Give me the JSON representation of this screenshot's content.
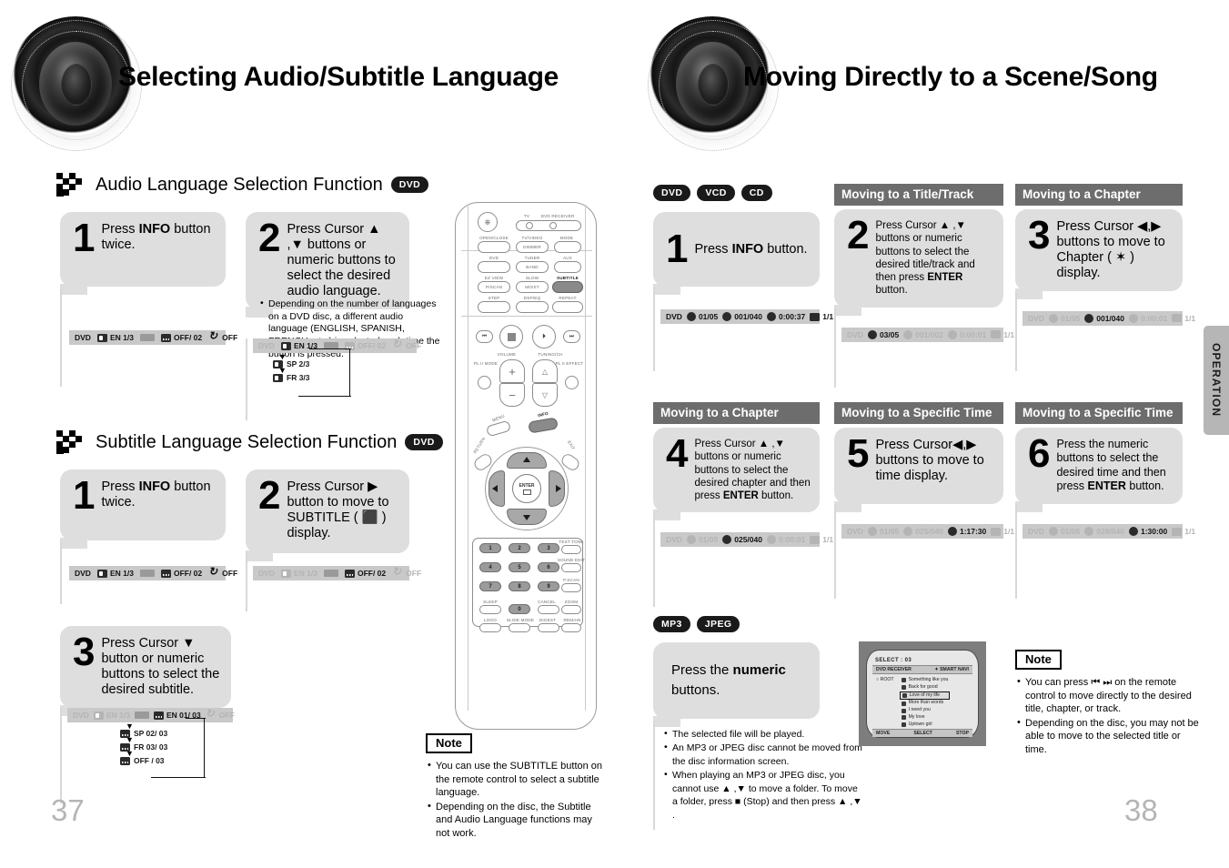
{
  "left_page": {
    "title": "Selecting Audio/Subtitle Language",
    "page_number": "37",
    "sections": [
      {
        "heading": "Audio Language Selection Function",
        "disc_badges": [
          "DVD"
        ],
        "steps": [
          {
            "number": "1",
            "text_before": "Press ",
            "text_bold": "INFO",
            "text_after": " button twice.",
            "osd": {
              "disc": "DVD",
              "audio": "EN 1/3",
              "subtitle": "OFF/ 02",
              "repeat": "OFF",
              "active": "audio"
            }
          },
          {
            "number": "2",
            "text_before": "Press Cursor ▲ ,▼ buttons or numeric buttons to select the desired audio language.",
            "text_bold": "",
            "text_after": "",
            "bullets": [
              "Depending on the number of languages on a DVD disc, a different audio language (ENGLISH, SPANISH, FRENCH, etc.) is selected each time the button is pressed."
            ],
            "osd": {
              "disc": "DVD",
              "audio": "EN 1/3",
              "subtitle": "OFF/ 02",
              "repeat": "OFF",
              "active": "audio"
            },
            "branch": [
              "SP 2/3",
              "FR 3/3"
            ]
          }
        ]
      },
      {
        "heading": "Subtitle Language Selection Function",
        "disc_badges": [
          "DVD"
        ],
        "steps": [
          {
            "number": "1",
            "text_before": "Press ",
            "text_bold": "INFO",
            "text_after": " button twice.",
            "osd": {
              "disc": "DVD",
              "audio": "EN 1/3",
              "subtitle": "OFF/ 02",
              "repeat": "OFF",
              "active": "audio"
            }
          },
          {
            "number": "2",
            "text_before": "Press Cursor ▶ button to move to SUBTITLE ( ⬛ ) display.",
            "text_bold": "",
            "text_after": "",
            "osd": {
              "disc": "DVD",
              "audio": "EN 1/3",
              "subtitle": "OFF/ 02",
              "repeat": "OFF",
              "active": "subtitle"
            }
          },
          {
            "number": "3",
            "text_before": "Press Cursor ▼ button or numeric buttons to select the desired subtitle.",
            "text_bold": "",
            "text_after": "",
            "osd": {
              "disc": "DVD",
              "audio": "EN 1/3",
              "subtitle": "EN 01/ 03",
              "repeat": "OFF",
              "active": "subtitle"
            },
            "branch": [
              "SP 02/ 03",
              "FR 03/ 03",
              "OFF / 03"
            ]
          }
        ]
      }
    ],
    "note": {
      "label": "Note",
      "items": [
        "You can use the SUBTITLE button on the remote control to select a subtitle language.",
        "Depending on the disc, the Subtitle and Audio Language functions may not work."
      ]
    },
    "remote": {
      "labels": {
        "tv": "TV",
        "dvd_receiver": "DVD RECEIVER",
        "open_close": "OPEN/CLOSE",
        "tv_video": "TV/VIDEO",
        "mode": "MODE",
        "dimmer": "DIMMER",
        "dvd": "DVD",
        "tuner": "TUNER",
        "band": "BAND",
        "aux": "AUX",
        "ez_view": "EZ VIEW",
        "slow": "SLOW",
        "subtitle": "SUBTITLE",
        "p_scan": "P/SCAN",
        "mo_st": "MO/ST",
        "step": "STEP",
        "dsp_eq": "DSP/EQ",
        "repeat": "REPEAT",
        "volume": "VOLUME",
        "tuning_ch": "TUNING/CH",
        "pl_mode": "PL II MODE",
        "pl_effect": "PL II EFFECT",
        "menu": "MENU",
        "info": "INFO",
        "return": "RETURN",
        "exit": "EXIT",
        "enter": "ENTER",
        "test_tone": "TEST TONE",
        "sound_edit": "SOUND EDIT",
        "p_scan2": "P.SCAN",
        "logo": "LOGO",
        "slide_mode": "SLIDE MODE",
        "digest": "DIGEST",
        "remain": "REMAIN",
        "sleep": "SLEEP",
        "cancel": "CANCEL",
        "zoom": "ZOOM"
      },
      "keypad": [
        "1",
        "2",
        "3",
        "4",
        "5",
        "6",
        "7",
        "8",
        "9",
        "0"
      ]
    }
  },
  "right_page": {
    "title": "Moving Directly to a Scene/Song",
    "page_number": "38",
    "disc_badges": [
      "DVD",
      "VCD",
      "CD"
    ],
    "side_tab": "OPERATION",
    "steps": [
      {
        "number": "1",
        "heading": "",
        "text_before": "Press ",
        "text_bold": "INFO",
        "text_after": " button.",
        "osd": {
          "disc": "DVD",
          "title": "01/05",
          "chapter": "001/040",
          "time": "0:00:37",
          "angle": "1/1",
          "active": "title"
        }
      },
      {
        "number": "2",
        "heading": "Moving to a Title/Track",
        "text_before": "Press Cursor ▲ ,▼ buttons or numeric buttons to select the desired title/track and then press ",
        "text_bold": "ENTER",
        "text_after": " button.",
        "osd": {
          "disc": "DVD",
          "title": "03/05",
          "chapter": "001/002",
          "time": "0:00:01",
          "angle": "1/1",
          "active": "title"
        }
      },
      {
        "number": "3",
        "heading": "Moving to a Chapter",
        "text_before": "Press Cursor ◀,▶ buttons to move to Chapter ( ✶ ) display.",
        "text_bold": "",
        "text_after": "",
        "osd": {
          "disc": "DVD",
          "title": "01/05",
          "chapter": "001/040",
          "time": "0:00:01",
          "angle": "1/1",
          "active": "chapter"
        }
      },
      {
        "number": "4",
        "heading": "Moving to a Chapter",
        "text_before": "Press Cursor ▲ ,▼ buttons or numeric buttons to select the desired chapter and then press ",
        "text_bold": "ENTER",
        "text_after": " button.",
        "osd": {
          "disc": "DVD",
          "title": "01/05",
          "chapter": "025/040",
          "time": "0:00:01",
          "angle": "1/1",
          "active": "chapter"
        }
      },
      {
        "number": "5",
        "heading": "Moving to a Specific Time",
        "text_before": "Press Cursor◀,▶ buttons to move to time display.",
        "text_bold": "",
        "text_after": "",
        "osd": {
          "disc": "DVD",
          "title": "01/05",
          "chapter": "025/040",
          "time": "1:17:30",
          "angle": "1/1",
          "active": "time"
        }
      },
      {
        "number": "6",
        "heading": "Moving to a Specific Time",
        "text_before": "Press the numeric buttons to select the desired time and then press ",
        "text_bold": "ENTER",
        "text_after": " button.",
        "osd": {
          "disc": "DVD",
          "title": "01/05",
          "chapter": "028/040",
          "time": "1:30:00",
          "angle": "1/1",
          "active": "time"
        }
      }
    ],
    "mp3_section": {
      "disc_badges": [
        "MP3",
        "JPEG"
      ],
      "step_text_before": "Press the ",
      "step_text_bold": "numeric",
      "step_text_after": " buttons.",
      "bullets": [
        "The selected file will be played.",
        "An MP3 or JPEG disc cannot be moved from the disc information screen.",
        "When playing an MP3 or JPEG disc, you cannot use ▲ ,▼ to move a folder. To move a folder, press ■ (Stop) and then press ▲ ,▼ ."
      ],
      "tv_screen": {
        "select_label": "SELECT :",
        "select_value": "03",
        "device": "DVD RECEIVER",
        "navi": "✦ SMART NAVI",
        "root": "ROOT",
        "songs": [
          "Something like you",
          "Back for good",
          "Love of my life",
          "More than words",
          "I need you",
          "My love",
          "Uptown girl"
        ],
        "selected_song_index": 2,
        "footer": [
          "MOVE",
          "SELECT",
          "STOP"
        ]
      }
    },
    "note": {
      "label": "Note",
      "items": [
        "You can press ⏮ ⏭  on the remote control to move directly to the desired title, chapter, or track.",
        "Depending on the disc, you may not be able to move to the selected title or time."
      ]
    }
  }
}
